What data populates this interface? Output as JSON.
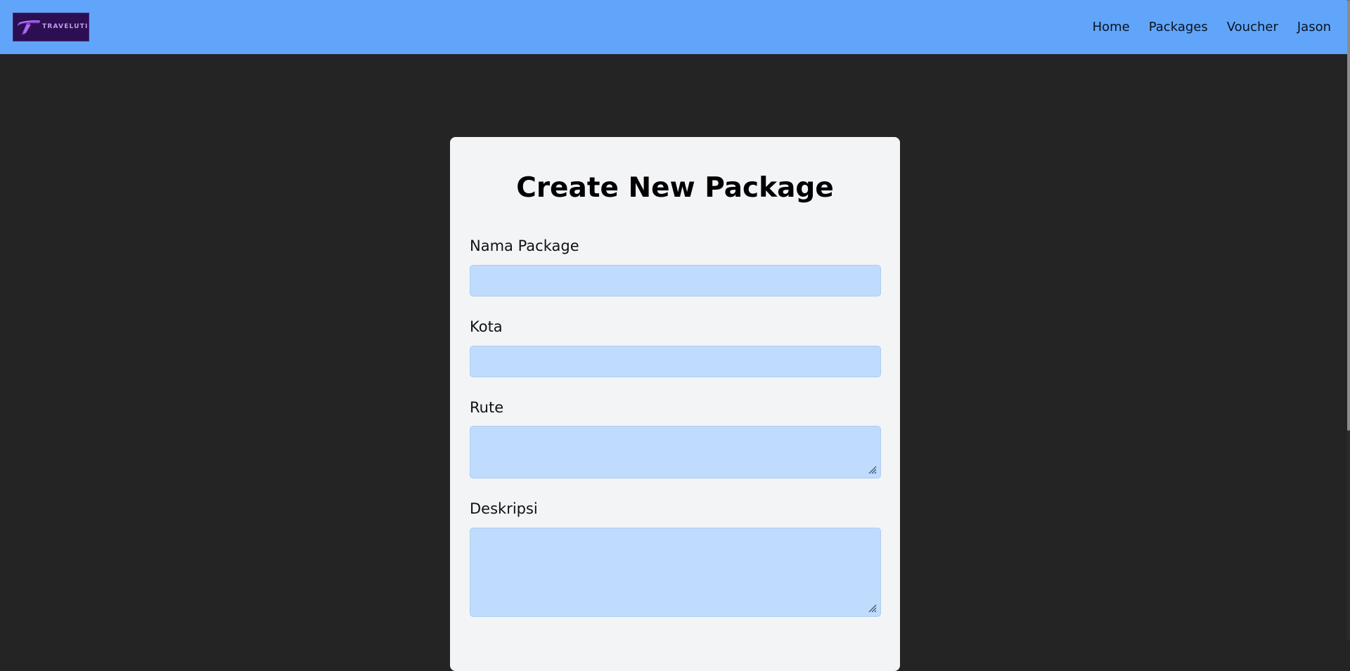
{
  "header": {
    "logo_text": "TRAVELUTION",
    "nav": [
      "Home",
      "Packages",
      "Voucher",
      "Jason"
    ]
  },
  "form": {
    "title": "Create New Package",
    "fields": [
      {
        "label": "Nama Package",
        "value": ""
      },
      {
        "label": "Kota",
        "value": ""
      },
      {
        "label": "Rute",
        "value": ""
      },
      {
        "label": "Deskripsi",
        "value": ""
      }
    ]
  },
  "colors": {
    "navbar": "#60a5fa",
    "page_background": "#242424",
    "card": "#f3f4f6",
    "input": "#bfdbfe",
    "logo_background": "#2b0f52"
  },
  "icons": [
    "travelution-logo-icon",
    "resize-grip-icon"
  ]
}
